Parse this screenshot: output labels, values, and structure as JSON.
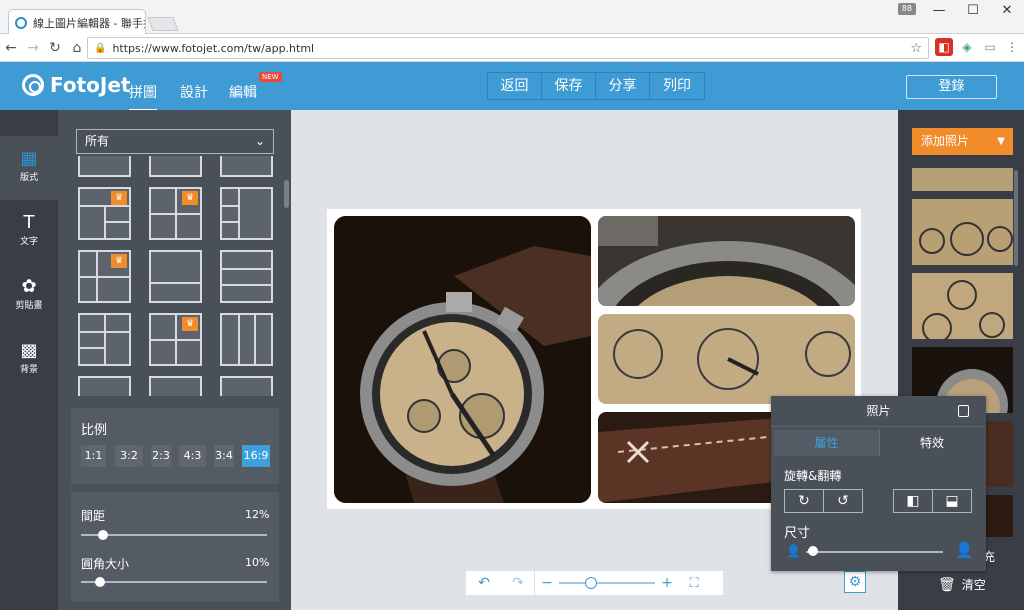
{
  "browser": {
    "tab_title": "線上圖片編輯器 - 聯手拉",
    "tab_close": "×",
    "url": "https://www.fotojet.com/tw/app.html",
    "counter": "88"
  },
  "header": {
    "logo": "FotoJet",
    "tabs": [
      "拼圖",
      "設計",
      "編輯"
    ],
    "new_badge": "NEW",
    "actions": [
      "返回",
      "保存",
      "分享",
      "列印"
    ],
    "login": "登錄"
  },
  "leftnav": [
    {
      "label": "版式",
      "icon": "layout-icon"
    },
    {
      "label": "文字",
      "icon": "text-icon"
    },
    {
      "label": "剪貼畫",
      "icon": "clipart-icon"
    },
    {
      "label": "背景",
      "icon": "background-icon"
    }
  ],
  "panel": {
    "filter_value": "所有",
    "ratio_title": "比例",
    "ratios": [
      "1:1",
      "3:2",
      "2:3",
      "4:3",
      "3:4",
      "16:9"
    ],
    "active_ratio": "16:9",
    "spacing_label": "間距",
    "spacing_value": "12%",
    "spacing_fraction": 0.12,
    "corner_label": "圓角大小",
    "corner_value": "10%",
    "corner_fraction": 0.1
  },
  "zoom": {
    "minus": "−",
    "plus": "+"
  },
  "right": {
    "add_photo": "添加照片",
    "fill_text": "充",
    "clear": "清空"
  },
  "popup": {
    "title": "照片",
    "tab_properties": "屬性",
    "tab_effects": "特效",
    "rotate_label": "旋轉&翻轉",
    "size_label": "尺寸"
  },
  "colors": {
    "accent": "#3f9bd3",
    "orange": "#f08c2a",
    "dark": "#393e46"
  }
}
